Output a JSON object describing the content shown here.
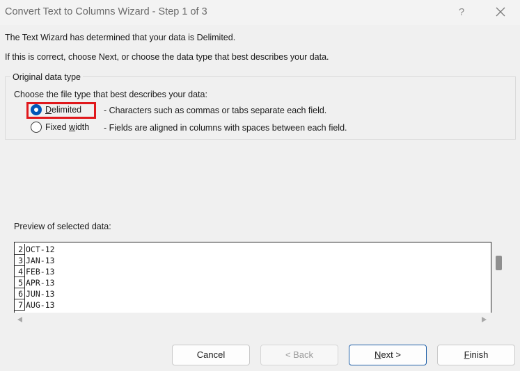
{
  "window": {
    "title": "Convert Text to Columns Wizard - Step 1 of 3",
    "help": "?"
  },
  "intro": {
    "line1": "The Text Wizard has determined that your data is Delimited.",
    "line2": "If this is correct, choose Next, or choose the data type that best describes your data."
  },
  "data_type": {
    "legend": "Original data type",
    "prompt": "Choose the file type that best describes your data:",
    "options": [
      {
        "label_pre": "",
        "label_ul": "D",
        "label_post": "elimited",
        "description": "- Characters such as commas or tabs separate each field.",
        "selected": true
      },
      {
        "label_pre": "Fixed ",
        "label_ul": "w",
        "label_post": "idth",
        "description": "- Fields are aligned in columns with spaces between each field.",
        "selected": false
      }
    ]
  },
  "preview": {
    "label": "Preview of selected data:",
    "rows": [
      {
        "num": "2",
        "value": "OCT-12"
      },
      {
        "num": "3",
        "value": "JAN-13"
      },
      {
        "num": "4",
        "value": "FEB-13"
      },
      {
        "num": "5",
        "value": "APR-13"
      },
      {
        "num": "6",
        "value": "JUN-13"
      },
      {
        "num": "7",
        "value": "AUG-13"
      }
    ]
  },
  "buttons": {
    "cancel": "Cancel",
    "back": "< Back",
    "next_ul": "N",
    "next_rest": "ext >",
    "finish_ul": "F",
    "finish_rest": "inish"
  },
  "colors": {
    "accent": "#0057b8",
    "highlight": "#e0181c"
  }
}
